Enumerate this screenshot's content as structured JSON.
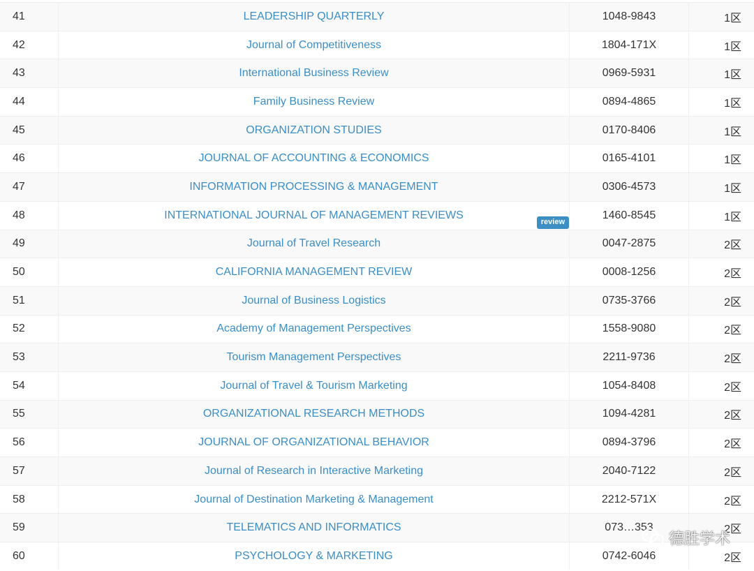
{
  "table": {
    "rows": [
      {
        "num": "41",
        "title": "LEADERSHIP QUARTERLY",
        "issn": "1048-9843",
        "zone": "1区"
      },
      {
        "num": "42",
        "title": "Journal of Competitiveness",
        "issn": "1804-171X",
        "zone": "1区"
      },
      {
        "num": "43",
        "title": "International Business Review",
        "issn": "0969-5931",
        "zone": "1区"
      },
      {
        "num": "44",
        "title": "Family Business Review",
        "issn": "0894-4865",
        "zone": "1区"
      },
      {
        "num": "45",
        "title": "ORGANIZATION STUDIES",
        "issn": "0170-8406",
        "zone": "1区"
      },
      {
        "num": "46",
        "title": "JOURNAL OF ACCOUNTING & ECONOMICS",
        "issn": "0165-4101",
        "zone": "1区"
      },
      {
        "num": "47",
        "title": "INFORMATION PROCESSING & MANAGEMENT",
        "issn": "0306-4573",
        "zone": "1区"
      },
      {
        "num": "48",
        "title": "INTERNATIONAL JOURNAL OF MANAGEMENT REVIEWS",
        "issn": "1460-8545",
        "zone": "1区",
        "badge": "review"
      },
      {
        "num": "49",
        "title": "Journal of Travel Research",
        "issn": "0047-2875",
        "zone": "2区"
      },
      {
        "num": "50",
        "title": "CALIFORNIA MANAGEMENT REVIEW",
        "issn": "0008-1256",
        "zone": "2区"
      },
      {
        "num": "51",
        "title": "Journal of Business Logistics",
        "issn": "0735-3766",
        "zone": "2区"
      },
      {
        "num": "52",
        "title": "Academy of Management Perspectives",
        "issn": "1558-9080",
        "zone": "2区"
      },
      {
        "num": "53",
        "title": "Tourism Management Perspectives",
        "issn": "2211-9736",
        "zone": "2区"
      },
      {
        "num": "54",
        "title": "Journal of Travel & Tourism Marketing",
        "issn": "1054-8408",
        "zone": "2区"
      },
      {
        "num": "55",
        "title": "ORGANIZATIONAL RESEARCH METHODS",
        "issn": "1094-4281",
        "zone": "2区"
      },
      {
        "num": "56",
        "title": "JOURNAL OF ORGANIZATIONAL BEHAVIOR",
        "issn": "0894-3796",
        "zone": "2区"
      },
      {
        "num": "57",
        "title": "Journal of Research in Interactive Marketing",
        "issn": "2040-7122",
        "zone": "2区"
      },
      {
        "num": "58",
        "title": "Journal of Destination Marketing & Management",
        "issn": "2212-571X",
        "zone": "2区"
      },
      {
        "num": "59",
        "title": "TELEMATICS AND INFORMATICS",
        "issn": "073…353",
        "zone": "2区"
      },
      {
        "num": "60",
        "title": "PSYCHOLOGY & MARKETING",
        "issn": "0742-6046",
        "zone": "2区"
      }
    ]
  },
  "watermark": {
    "text": "德胜学术",
    "icon": "wechat-icon"
  },
  "colors": {
    "link": "#3a8ec8",
    "badge": "#3b8fc2",
    "stripe": "#f9f9f9"
  }
}
